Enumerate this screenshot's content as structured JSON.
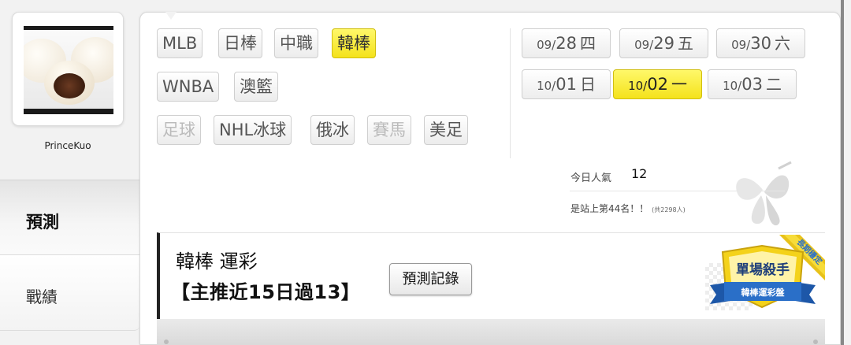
{
  "user": {
    "name": "PrinceKuo"
  },
  "sidebar": {
    "items": [
      {
        "label": "預測",
        "active": true
      },
      {
        "label": "戰績",
        "active": false
      }
    ]
  },
  "sports": [
    {
      "label": "MLB",
      "state": "normal"
    },
    {
      "label": "日棒",
      "state": "normal"
    },
    {
      "label": "中職",
      "state": "normal"
    },
    {
      "label": "韓棒",
      "state": "active"
    },
    {
      "label": "WNBA",
      "state": "normal"
    },
    {
      "label": "澳籃",
      "state": "normal"
    },
    {
      "label": "足球",
      "state": "disabled"
    },
    {
      "label": "NHL冰球",
      "state": "normal"
    },
    {
      "label": "俄冰",
      "state": "normal"
    },
    {
      "label": "賽馬",
      "state": "disabled"
    },
    {
      "label": "美足",
      "state": "normal"
    }
  ],
  "dates": [
    {
      "month": "09/",
      "day": "28",
      "weekday": "四",
      "active": false
    },
    {
      "month": "09/",
      "day": "29",
      "weekday": "五",
      "active": false
    },
    {
      "month": "09/",
      "day": "30",
      "weekday": "六",
      "active": false
    },
    {
      "month": "10/",
      "day": "01",
      "weekday": "日",
      "active": false
    },
    {
      "month": "10/",
      "day": "02",
      "weekday": "一",
      "active": true
    },
    {
      "month": "10/",
      "day": "03",
      "weekday": "二",
      "active": false
    }
  ],
  "stats": {
    "popularity_label": "今日人氣",
    "popularity_value": "12",
    "rank_text": "是站上第44名！！",
    "rank_total": "(共2298人)"
  },
  "lottery": {
    "title": "韓棒 運彩",
    "subtitle": "【主推近15日過13】",
    "history_button": "預測記錄"
  },
  "badge": {
    "main": "單場殺手",
    "sub": "韓棒運彩盤",
    "ribbon": "長期穩定"
  },
  "colors": {
    "active_yellow": "#f4e21b",
    "badge_blue": "#2a6fc8",
    "badge_gold": "#e8c21a"
  }
}
